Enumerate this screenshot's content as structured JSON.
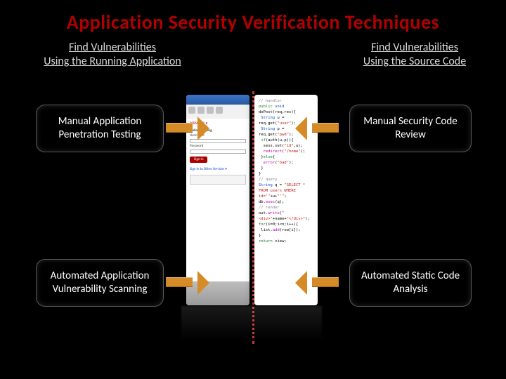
{
  "title": "Application Security Verification Techniques",
  "left_column_heading": "Find Vulnerabilities\nUsing the Running Application",
  "right_column_heading": "Find Vulnerabilities\nUsing the Source Code",
  "methods": {
    "top_left": "Manual Application Penetration Testing",
    "top_right": "Manual Security Code Review",
    "bottom_left": "Automated Application Vulnerability Scanning",
    "bottom_right": "Automated Static Code Analysis"
  },
  "center": {
    "left_pane": "running-application-mock",
    "right_pane": "source-code-mock"
  },
  "icons": {
    "arrow": "arrow-icon"
  }
}
